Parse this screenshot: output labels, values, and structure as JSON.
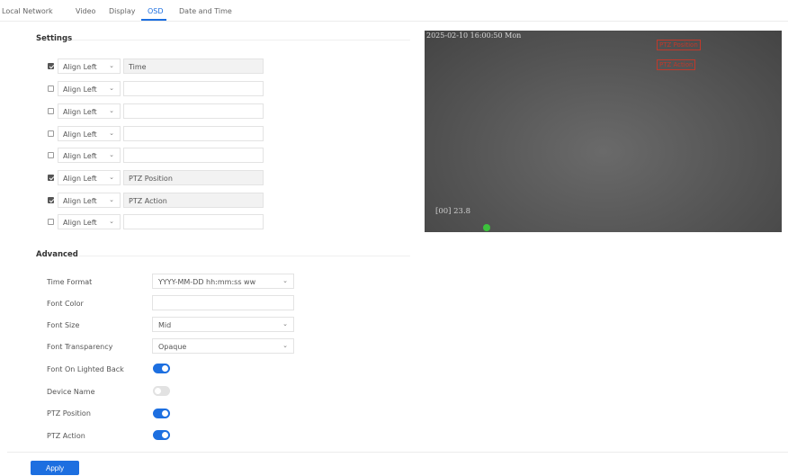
{
  "tabs": [
    {
      "label": "Local Network"
    },
    {
      "label": "Video"
    },
    {
      "label": "Display"
    },
    {
      "label": "OSD"
    },
    {
      "label": "Date and Time"
    }
  ],
  "active_tab": "OSD",
  "settings": {
    "title": "Settings",
    "rows": [
      {
        "checked": true,
        "align": "Align Left",
        "text": "Time",
        "disabled": true
      },
      {
        "checked": false,
        "align": "Align Left",
        "text": "",
        "disabled": false
      },
      {
        "checked": false,
        "align": "Align Left",
        "text": "",
        "disabled": false
      },
      {
        "checked": false,
        "align": "Align Left",
        "text": "",
        "disabled": false
      },
      {
        "checked": false,
        "align": "Align Left",
        "text": "",
        "disabled": false
      },
      {
        "checked": true,
        "align": "Align Left",
        "text": "PTZ Position",
        "disabled": true
      },
      {
        "checked": true,
        "align": "Align Left",
        "text": "PTZ Action",
        "disabled": true
      },
      {
        "checked": false,
        "align": "Align Left",
        "text": "",
        "disabled": false
      }
    ]
  },
  "advanced": {
    "title": "Advanced",
    "time_format": {
      "label": "Time Format",
      "value": "YYYY-MM-DD hh:mm:ss ww"
    },
    "font_color": {
      "label": "Font Color",
      "value": ""
    },
    "font_size": {
      "label": "Font Size",
      "value": "Mid"
    },
    "font_transparency": {
      "label": "Font Transparency",
      "value": "Opaque"
    },
    "font_on_lighted_back": {
      "label": "Font On Lighted Back",
      "on": true
    },
    "device_name": {
      "label": "Device Name",
      "on": false
    },
    "ptz_position": {
      "label": "PTZ Position",
      "on": true
    },
    "ptz_action": {
      "label": "PTZ Action",
      "on": true
    }
  },
  "preview": {
    "timestamp": "2025-02-10 16:00:50 Mon",
    "ptz_position_box": "PTZ Position",
    "ptz_action_box": "PTZ Action",
    "zoom_text": "[00] 23.8"
  },
  "apply_label": "Apply",
  "colors": {
    "accent": "#1d6fe0",
    "osd_box": "#c0392b",
    "status_dot": "#3cc23c"
  }
}
